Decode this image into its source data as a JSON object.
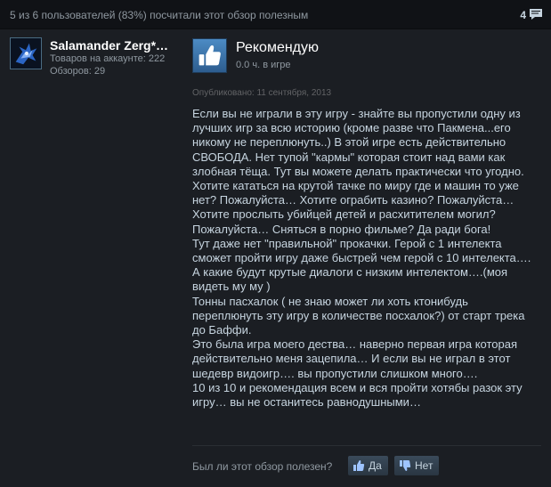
{
  "header": {
    "helpful_text": "5 из 6 пользователей (83%) посчитали этот обзор полезным",
    "comment_count": "4"
  },
  "author": {
    "name": "Salamander Zerg*…",
    "games_owned": "Товаров на аккаунте: 222",
    "reviews": "Обзоров: 29"
  },
  "review": {
    "verdict": "Рекомендую",
    "hours": "0.0 ч. в игре",
    "posted": "Опубликовано: 11 сентября, 2013",
    "lines": [
      "Если вы не играли в эту игру - знайте вы пропустили одну из",
      "лучших игр за всю историю (кроме разве что Пакмена...его",
      "никому не переплюнуть..) В этой игре есть действительно",
      "СВОБОДА. Нет тупой \"кармы\" которая стоит над вами как",
      "злобная тёща. Тут вы можете делать практически что угодно.",
      "Хотите кататься на крутой тачке по миру где и машин то уже",
      "нет? Пожалуйста… Хотите ограбить казино? Пожалуйста…",
      "Хотите прослыть убийцей детей и расхитителем могил?",
      "Пожалуйста… Сняться в порно фильме? Да ради бога!",
      "Тут даже нет \"правильной\" прокачки. Герой с 1 интелекта",
      "сможет пройти игру даже быстрей чем герой с 10 интелекта….",
      "А какие будут крутые диалоги с низким интелектом….(моя",
      "видеть му му )",
      "Тонны пасхалок ( не знаю может ли хоть ктонибудь",
      "переплюнуть эту игру в количестве посхалок?) от старт трека",
      "до Баффи.",
      "Это была игра моего дества… наверно первая игра которая",
      "действительно меня зацепила… И если вы не играл в этот",
      "шедевр видоигр…. вы пропустили слишком много….",
      "10 из 10 и рекомендация всем и вся пройти хотябы разок эту",
      "игру… вы не останитесь равнодушными…"
    ]
  },
  "feedback": {
    "question": "Был ли этот обзор полезен?",
    "yes_label": "Да",
    "no_label": "Нет"
  },
  "colors": {
    "background": "#1b1e23",
    "topbar": "#101216",
    "accent_blue": "#4c8bc4",
    "text": "#c6d4df",
    "muted": "#8f98a0"
  }
}
